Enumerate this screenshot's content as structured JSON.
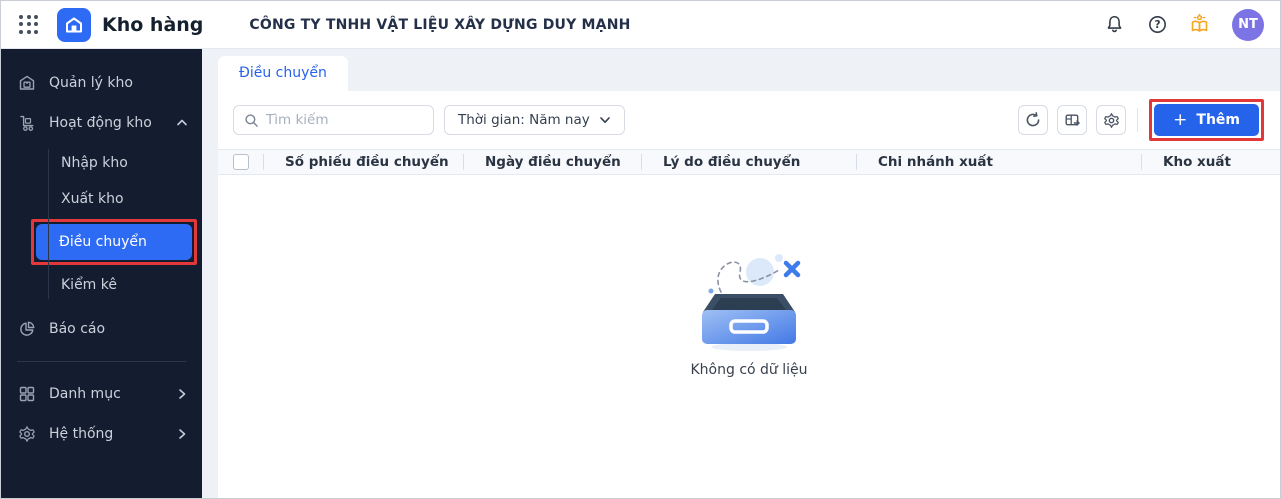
{
  "topbar": {
    "app_title": "Kho hàng",
    "company": "CÔNG TY TNHH VẬT LIỆU XÂY DỰNG DUY MẠNH",
    "avatar_initials": "NT"
  },
  "sidebar": {
    "items": [
      {
        "label": "Quản lý kho",
        "icon": "warehouse-icon"
      },
      {
        "label": "Hoạt động kho",
        "icon": "trolley-icon",
        "expanded": true
      },
      {
        "label": "Báo cáo",
        "icon": "pie-chart-icon"
      },
      {
        "label": "Danh mục",
        "icon": "grid-icon",
        "collapsed": true
      },
      {
        "label": "Hệ thống",
        "icon": "gear-icon",
        "collapsed": true
      }
    ],
    "sub_items": [
      {
        "label": "Nhập kho",
        "active": false
      },
      {
        "label": "Xuất kho",
        "active": false
      },
      {
        "label": "Điều chuyển",
        "active": true,
        "annotated": true
      },
      {
        "label": "Kiểm kê",
        "active": false
      }
    ]
  },
  "main": {
    "tab_label": "Điều chuyển",
    "search_placeholder": "Tìm kiếm",
    "time_filter_label": "Thời gian: Năm nay",
    "add_button_label": "Thêm",
    "add_button_plus": "+",
    "table": {
      "headers": [
        "Số phiếu điều chuyển",
        "Ngày điều chuyển",
        "Lý do điều chuyển",
        "Chi nhánh xuất",
        "Kho xuất"
      ],
      "rows": []
    },
    "empty_state_text": "Không có dữ liệu"
  },
  "colors": {
    "accent_blue": "#2563eb",
    "sidebar_bg": "#141d2f",
    "active_item_blue": "#2e6bf4",
    "annotation_red": "#e2383c",
    "avatar_purple": "#7c74e4",
    "guide_orange": "#f5a623"
  }
}
